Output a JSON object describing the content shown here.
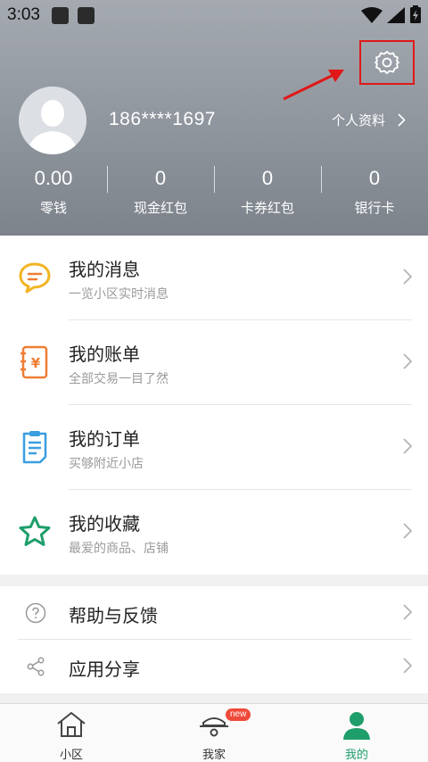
{
  "status_bar": {
    "time": "3:03"
  },
  "profile": {
    "phone": "186****1697",
    "profile_link_label": "个人资料"
  },
  "stats": [
    {
      "value": "0.00",
      "label": "零钱"
    },
    {
      "value": "0",
      "label": "现金红包"
    },
    {
      "value": "0",
      "label": "卡券红包"
    },
    {
      "value": "0",
      "label": "银行卡"
    }
  ],
  "menu": [
    {
      "title": "我的消息",
      "subtitle": "一览小区实时消息",
      "icon": "message-icon",
      "color": "#f2b422"
    },
    {
      "title": "我的账单",
      "subtitle": "全部交易一目了然",
      "icon": "bill-icon",
      "color": "#ef7d33"
    },
    {
      "title": "我的订单",
      "subtitle": "买够附近小店",
      "icon": "order-icon",
      "color": "#3a9ee0"
    },
    {
      "title": "我的收藏",
      "subtitle": "最爱的商品、店铺",
      "icon": "star-icon",
      "color": "#1e9e6a"
    }
  ],
  "secondary_menu": [
    {
      "title": "帮助与反馈",
      "icon": "help-icon"
    },
    {
      "title": "应用分享",
      "icon": "share-icon"
    }
  ],
  "tabs": [
    {
      "label": "小区",
      "icon": "home-icon"
    },
    {
      "label": "我家",
      "icon": "family-icon",
      "badge": "new"
    },
    {
      "label": "我的",
      "icon": "person-icon",
      "active": true
    }
  ],
  "colors": {
    "accent": "#1e9e6a",
    "highlight_box": "#e01818"
  }
}
